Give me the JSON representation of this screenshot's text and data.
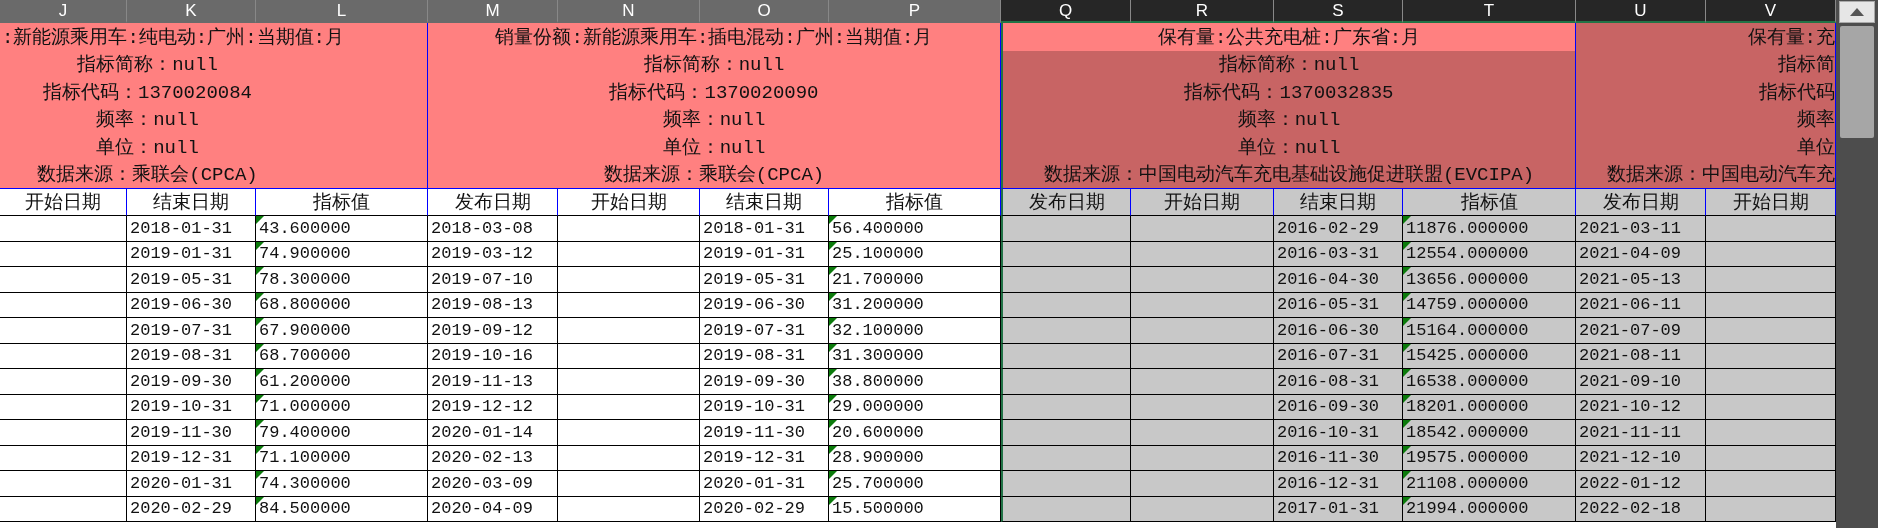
{
  "column_letters": [
    {
      "label": "J",
      "selected": false
    },
    {
      "label": "K",
      "selected": false
    },
    {
      "label": "L",
      "selected": false
    },
    {
      "label": "M",
      "selected": false
    },
    {
      "label": "N",
      "selected": false
    },
    {
      "label": "O",
      "selected": false
    },
    {
      "label": "P",
      "selected": false
    },
    {
      "label": "Q",
      "selected": true
    },
    {
      "label": "R",
      "selected": true
    },
    {
      "label": "S",
      "selected": true
    },
    {
      "label": "T",
      "selected": true
    },
    {
      "label": "U",
      "selected": true
    },
    {
      "label": "V",
      "selected": true
    }
  ],
  "blocks": [
    {
      "kind": "cut_left",
      "selected": false,
      "info_lines": [
        ":新能源乘用车:纯电动:广州:当期值:月",
        "指标简称：null",
        "指标代码：1370020084",
        "频率：null",
        "单位：null",
        "数据来源：乘联会(CPCA)"
      ],
      "columns": [
        {
          "header": "开始日期",
          "kind": "start_date"
        },
        {
          "header": "结束日期",
          "kind": "end_date"
        },
        {
          "header": "指标值",
          "kind": "value"
        }
      ],
      "rows": [
        {
          "end_date": "2018-01-31",
          "value": "43.600000"
        },
        {
          "end_date": "2019-01-31",
          "value": "74.900000"
        },
        {
          "end_date": "2019-05-31",
          "value": "78.300000"
        },
        {
          "end_date": "2019-06-30",
          "value": "68.800000"
        },
        {
          "end_date": "2019-07-31",
          "value": "67.900000"
        },
        {
          "end_date": "2019-08-31",
          "value": "68.700000"
        },
        {
          "end_date": "2019-09-30",
          "value": "61.200000"
        },
        {
          "end_date": "2019-10-31",
          "value": "71.000000"
        },
        {
          "end_date": "2019-11-30",
          "value": "79.400000"
        },
        {
          "end_date": "2019-12-31",
          "value": "71.100000"
        },
        {
          "end_date": "2020-01-31",
          "value": "74.300000"
        },
        {
          "end_date": "2020-02-29",
          "value": "84.500000"
        }
      ]
    },
    {
      "kind": "whole",
      "selected": false,
      "info_lines": [
        "销量份额:新能源乘用车:插电混动:广州:当期值:月",
        "指标简称：null",
        "指标代码：1370020090",
        "频率：null",
        "单位：null",
        "数据来源：乘联会(CPCA)"
      ],
      "columns": [
        {
          "header": "发布日期",
          "kind": "publish_date"
        },
        {
          "header": "开始日期",
          "kind": "start_date"
        },
        {
          "header": "结束日期",
          "kind": "end_date"
        },
        {
          "header": "指标值",
          "kind": "value"
        }
      ],
      "rows": [
        {
          "publish_date": "2018-03-08",
          "end_date": "2018-01-31",
          "value": "56.400000"
        },
        {
          "publish_date": "2019-03-12",
          "end_date": "2019-01-31",
          "value": "25.100000"
        },
        {
          "publish_date": "2019-07-10",
          "end_date": "2019-05-31",
          "value": "21.700000"
        },
        {
          "publish_date": "2019-08-13",
          "end_date": "2019-06-30",
          "value": "31.200000"
        },
        {
          "publish_date": "2019-09-12",
          "end_date": "2019-07-31",
          "value": "32.100000"
        },
        {
          "publish_date": "2019-10-16",
          "end_date": "2019-08-31",
          "value": "31.300000"
        },
        {
          "publish_date": "2019-11-13",
          "end_date": "2019-09-30",
          "value": "38.800000"
        },
        {
          "publish_date": "2019-12-12",
          "end_date": "2019-10-31",
          "value": "29.000000"
        },
        {
          "publish_date": "2020-01-14",
          "end_date": "2019-11-30",
          "value": "20.600000"
        },
        {
          "publish_date": "2020-02-13",
          "end_date": "2019-12-31",
          "value": "28.900000"
        },
        {
          "publish_date": "2020-03-09",
          "end_date": "2020-01-31",
          "value": "25.700000"
        },
        {
          "publish_date": "2020-04-09",
          "end_date": "2020-02-29",
          "value": "15.500000"
        }
      ]
    },
    {
      "kind": "whole",
      "selected": true,
      "active": true,
      "info_lines": [
        "保有量:公共充电桩:广东省:月",
        "指标简称：null",
        "指标代码：1370032835",
        "频率：null",
        "单位：null",
        "数据来源：中国电动汽车充电基础设施促进联盟(EVCIPA)"
      ],
      "columns": [
        {
          "header": "发布日期",
          "kind": "publish_date"
        },
        {
          "header": "开始日期",
          "kind": "start_date"
        },
        {
          "header": "结束日期",
          "kind": "end_date"
        },
        {
          "header": "指标值",
          "kind": "value"
        }
      ],
      "rows": [
        {
          "end_date": "2016-02-29",
          "value": "11876.000000"
        },
        {
          "end_date": "2016-03-31",
          "value": "12554.000000"
        },
        {
          "end_date": "2016-04-30",
          "value": "13656.000000"
        },
        {
          "end_date": "2016-05-31",
          "value": "14759.000000"
        },
        {
          "end_date": "2016-06-30",
          "value": "15164.000000"
        },
        {
          "end_date": "2016-07-31",
          "value": "15425.000000"
        },
        {
          "end_date": "2016-08-31",
          "value": "16538.000000"
        },
        {
          "end_date": "2016-09-30",
          "value": "18201.000000"
        },
        {
          "end_date": "2016-10-31",
          "value": "18542.000000"
        },
        {
          "end_date": "2016-11-30",
          "value": "19575.000000"
        },
        {
          "end_date": "2016-12-31",
          "value": "21108.000000"
        },
        {
          "end_date": "2017-01-31",
          "value": "21994.000000"
        }
      ]
    },
    {
      "kind": "cut_right",
      "selected": true,
      "active": false,
      "info_lines": [
        "保有量:充",
        "指标简",
        "指标代码",
        "频率",
        "单位",
        "数据来源：中国电动汽车充"
      ],
      "columns": [
        {
          "header": "发布日期",
          "kind": "publish_date"
        },
        {
          "header": "开始日期",
          "kind": "start_date"
        }
      ],
      "rows": [
        {
          "publish_date": "2021-03-11"
        },
        {
          "publish_date": "2021-04-09"
        },
        {
          "publish_date": "2021-05-13"
        },
        {
          "publish_date": "2021-06-11"
        },
        {
          "publish_date": "2021-07-09"
        },
        {
          "publish_date": "2021-08-11"
        },
        {
          "publish_date": "2021-09-10"
        },
        {
          "publish_date": "2021-10-12"
        },
        {
          "publish_date": "2021-11-11"
        },
        {
          "publish_date": "2021-12-10"
        },
        {
          "publish_date": "2022-01-12"
        },
        {
          "publish_date": "2022-02-18"
        }
      ]
    }
  ]
}
